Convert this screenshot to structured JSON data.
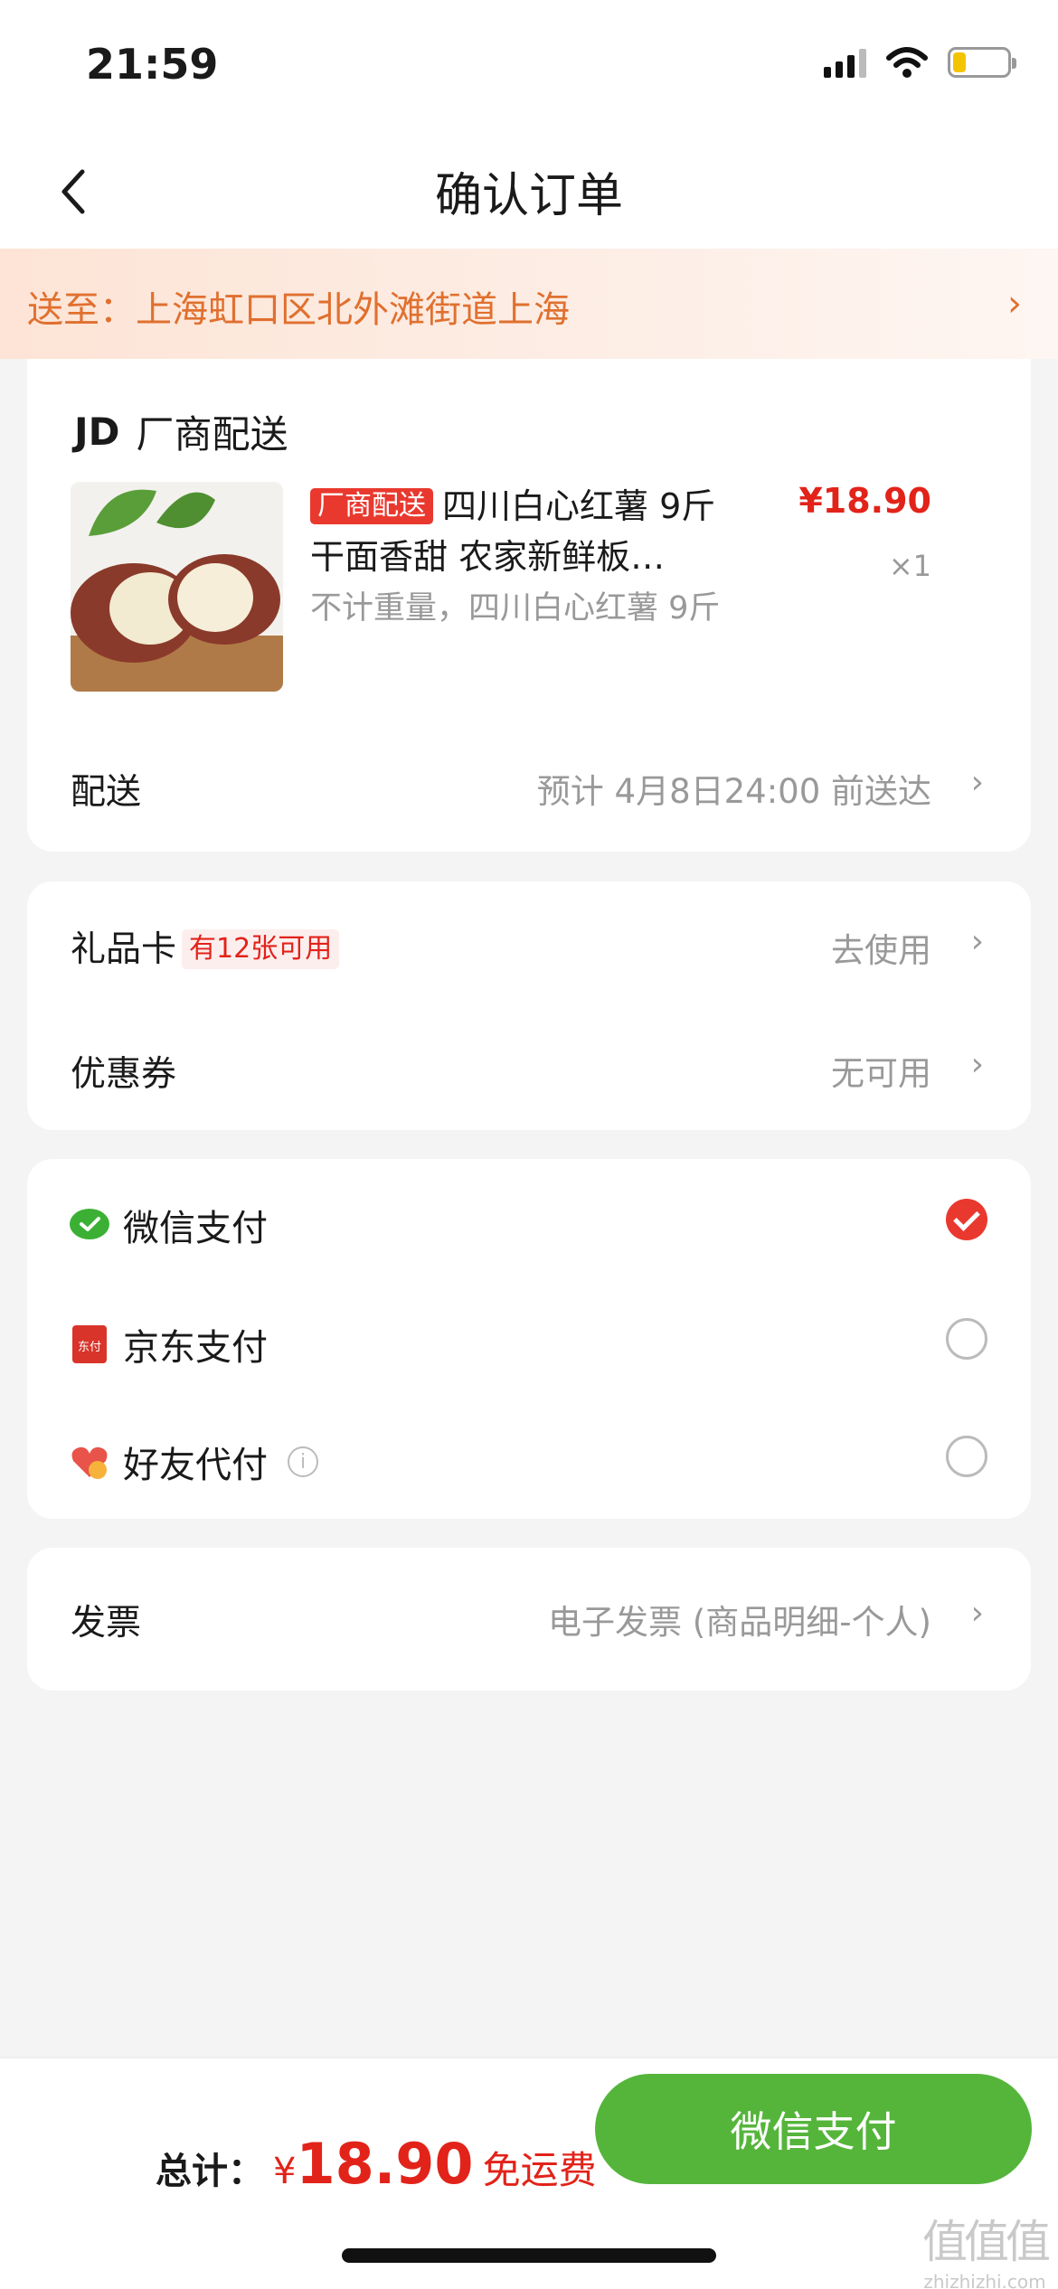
{
  "status_bar": {
    "time": "21:59"
  },
  "nav": {
    "title": "确认订单"
  },
  "address": {
    "text": "送至：上海虹口区北外滩街道上海"
  },
  "order": {
    "seller_logo": "JD",
    "seller_name": "厂商配送",
    "product": {
      "tag": "厂商配送",
      "title": "四川白心红薯 9斤 干面香甜 农家新鲜板…",
      "spec": "不计重量，四川白心红薯 9斤",
      "price": "¥18.90",
      "quantity": "×1"
    },
    "delivery": {
      "label": "配送",
      "value": "预计 4月8日24:00 前送达"
    }
  },
  "discounts": {
    "gift_card": {
      "label": "礼品卡",
      "badge": "有12张可用",
      "value": "去使用"
    },
    "coupon": {
      "label": "优惠券",
      "value": "无可用"
    }
  },
  "payment": {
    "methods": [
      {
        "label": "微信支付",
        "icon": "wechat-pay-icon",
        "selected": true
      },
      {
        "label": "京东支付",
        "icon": "jd-pay-icon",
        "selected": false
      },
      {
        "label": "好友代付",
        "icon": "friend-pay-icon",
        "selected": false
      }
    ],
    "jd_icon_text": "东付",
    "info_icon_text": "i"
  },
  "invoice": {
    "label": "发票",
    "value": "电子发票 (商品明细-个人)"
  },
  "footer": {
    "total_label": "总计：",
    "currency": "¥",
    "amount": "18.90",
    "shipping_note": "免运费",
    "pay_button": "微信支付"
  },
  "watermark": {
    "logo": "值值值",
    "site": "zhizhizhi.com"
  },
  "colors": {
    "accent_red": "#e2231a",
    "address_orange": "#e0702f",
    "pay_green": "#55b53b",
    "wechat_green": "#3cb034"
  }
}
